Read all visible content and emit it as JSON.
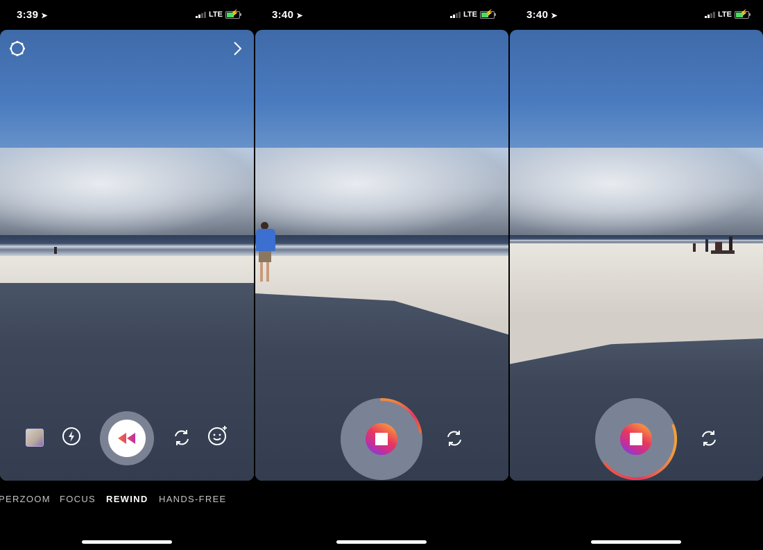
{
  "panels": [
    {
      "status": {
        "time": "3:39",
        "network": "LTE"
      },
      "top_controls": {
        "settings_icon": "gear-icon",
        "next_icon": "chevron-right-icon"
      },
      "bottom_controls": {
        "gallery_icon": "gallery-thumbnail",
        "flash_icon": "flash-icon",
        "shutter_icon": "rewind-icon",
        "flip_icon": "flip-camera-icon",
        "effects_icon": "face-effects-icon"
      },
      "modes": [
        {
          "label": "PERZOOM",
          "active": false
        },
        {
          "label": "FOCUS",
          "active": false
        },
        {
          "label": "REWIND",
          "active": true
        },
        {
          "label": "HANDS-FREE",
          "active": false
        }
      ]
    },
    {
      "status": {
        "time": "3:40",
        "network": "LTE"
      },
      "recording": {
        "stop_icon": "stop-icon",
        "progress": 0.22
      },
      "flip_icon": "flip-camera-icon"
    },
    {
      "status": {
        "time": "3:40",
        "network": "LTE"
      },
      "recording": {
        "stop_icon": "stop-icon",
        "progress": 0.45
      },
      "flip_icon": "flip-camera-icon"
    }
  ],
  "colors": {
    "accent_gradient": [
      "#f9a33a",
      "#e8375d",
      "#b42fb6",
      "#7b3fe4"
    ],
    "shutter_ring": "#7b8294",
    "active_mode": "#ffffff",
    "inactive_mode": "#c4c4c4",
    "battery": "#4cd964"
  }
}
